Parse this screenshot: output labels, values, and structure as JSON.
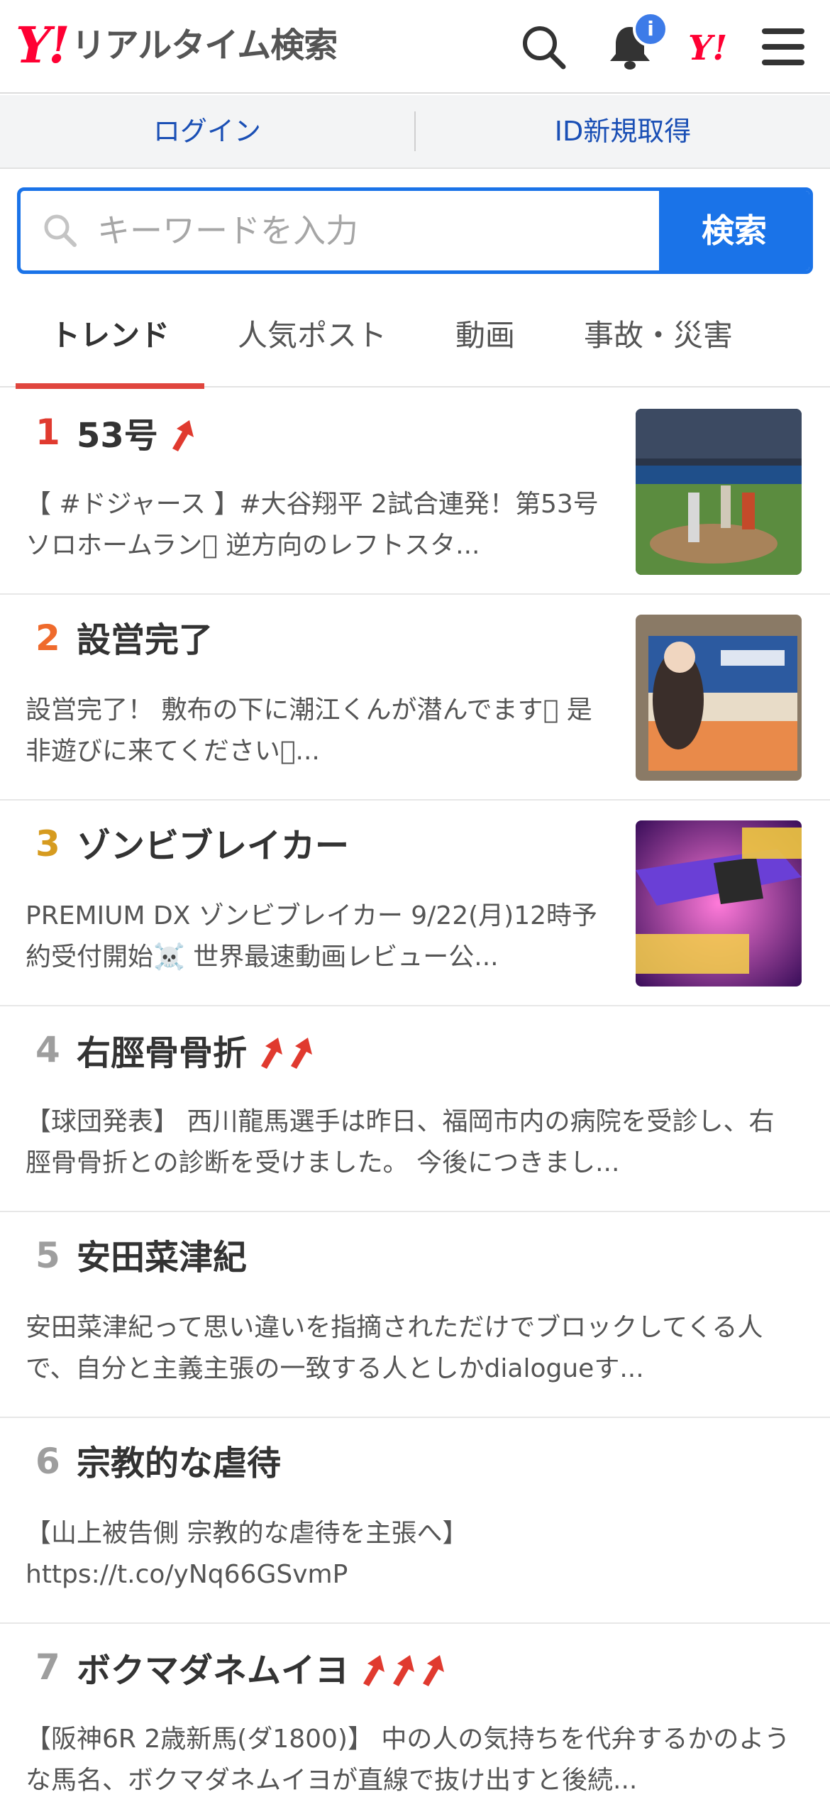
{
  "header": {
    "logo_mark": "Y!",
    "logo_text": "リアルタイム検索",
    "badge": "i",
    "yj_mark": "Y!"
  },
  "loginbar": {
    "login": "ログイン",
    "register": "ID新規取得"
  },
  "search": {
    "placeholder": "キーワードを入力",
    "button": "検索"
  },
  "tabs": [
    "トレンド",
    "人気ポスト",
    "動画",
    "事故・災害"
  ],
  "colors": {
    "accent_blue": "#1a73e8",
    "brand_red": "#ff0033",
    "tab_underline": "#e0463e",
    "rank1": "#e03a2f",
    "rank2": "#ef6a2c",
    "rank3": "#d69b1f",
    "rank_other": "#9e9e9e"
  },
  "trends": [
    {
      "rank": "1",
      "title": "53号",
      "arrows": 1,
      "thumb": "baseball-photo",
      "desc": "【 #ドジャース 】#大谷翔平 2試合連発！第53号ソロホームラン􏰀 逆方向のレフトスタ..."
    },
    {
      "rank": "2",
      "title": "設営完了",
      "arrows": 0,
      "thumb": "anime-banner-photo",
      "desc": "設営完了！ 敷布の下に潮江くんが潜んでます􏰀 是非遊びに来てください􏰀..."
    },
    {
      "rank": "3",
      "title": "ゾンビブレイカー",
      "arrows": 0,
      "thumb": "toy-sword-promo",
      "desc": "PREMIUM DX ゾンビブレイカー 9/22(月)12時予約受付開始☠️ 世界最速動画レビュー公..."
    },
    {
      "rank": "4",
      "title": "右脛骨骨折",
      "arrows": 2,
      "thumb": "",
      "desc": "【球団発表】 西川龍馬選手は昨日、福岡市内の病院を受診し、右脛骨骨折との診断を受けました。 今後につきまし..."
    },
    {
      "rank": "5",
      "title": "安田菜津紀",
      "arrows": 0,
      "thumb": "",
      "desc": "安田菜津紀って思い違いを指摘されただけでブロックしてくる人で、自分と主義主張の一致する人としかdialogueす..."
    },
    {
      "rank": "6",
      "title": "宗教的な虐待",
      "arrows": 0,
      "thumb": "",
      "desc": "【山上被告側 宗教的な虐待を主張へ】 https://t.co/yNq66GSvmP"
    },
    {
      "rank": "7",
      "title": "ボクマダネムイヨ",
      "arrows": 3,
      "thumb": "",
      "desc": "【阪神6R 2歳新馬(ダ1800)】 中の人の気持ちを代弁するかのような馬名、ボクマダネムイヨが直線で抜け出すと後続..."
    }
  ]
}
